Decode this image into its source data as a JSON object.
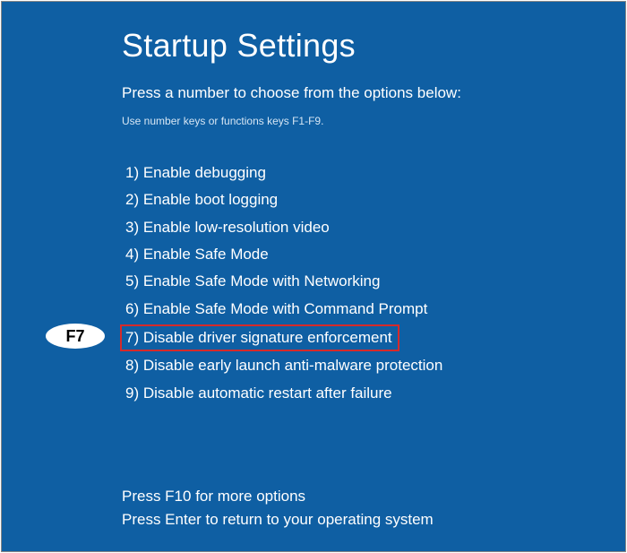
{
  "title": "Startup Settings",
  "subtitle": "Press a number to choose from the options below:",
  "helper": "Use number keys or functions keys F1-F9.",
  "options": [
    "1) Enable debugging",
    "2) Enable boot logging",
    "3) Enable low-resolution video",
    "4) Enable Safe Mode",
    "5) Enable Safe Mode with Networking",
    "6) Enable Safe Mode with Command Prompt",
    "7) Disable driver signature enforcement",
    "8) Disable early launch anti-malware protection",
    "9) Disable automatic restart after failure"
  ],
  "highlighted_index": 6,
  "badge_label": "F7",
  "footer": {
    "line1": "Press F10 for more options",
    "line2": "Press Enter to return to your operating system"
  }
}
